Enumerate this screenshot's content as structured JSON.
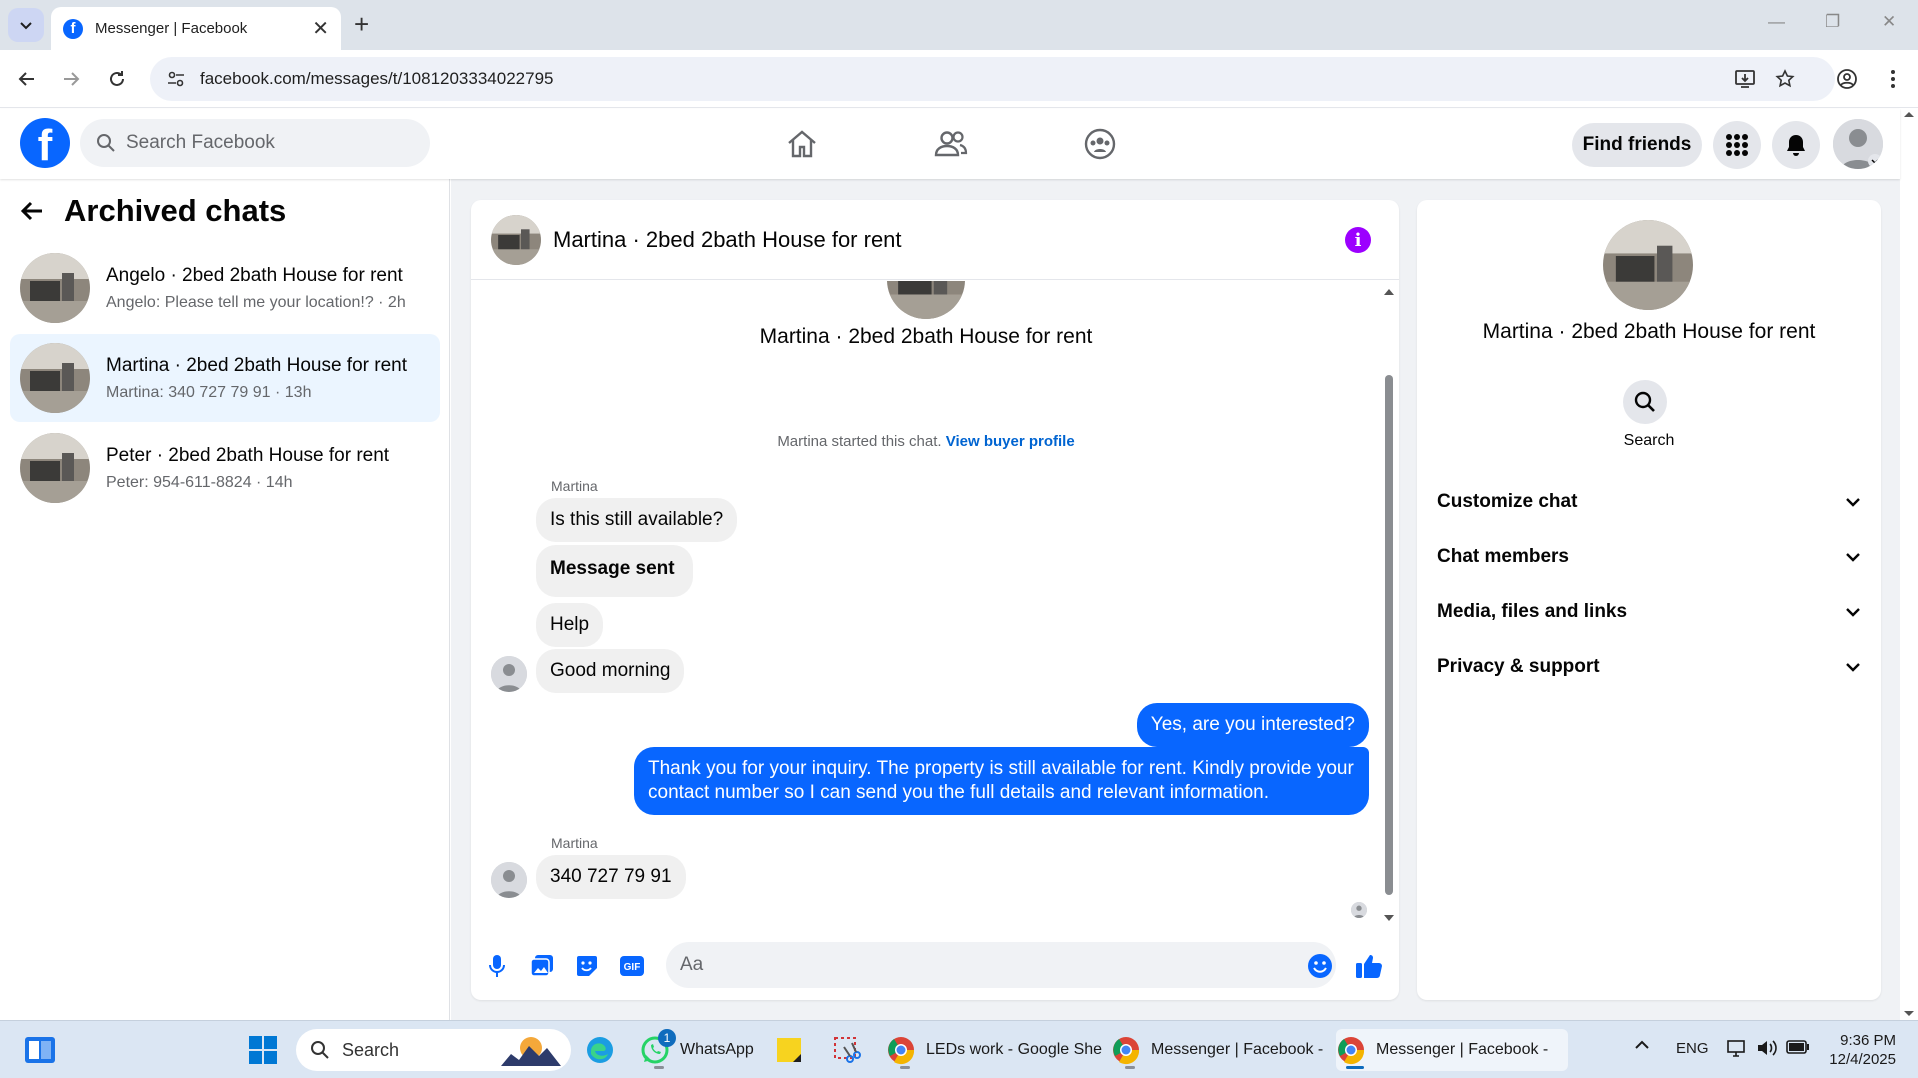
{
  "browser": {
    "tab_title": "Messenger | Facebook",
    "url": "facebook.com/messages/t/1081203334022795"
  },
  "fb_header": {
    "search_placeholder": "Search Facebook",
    "find_friends": "Find friends"
  },
  "sidebar": {
    "title": "Archived chats",
    "chats": [
      {
        "name": "Angelo · 2bed 2bath House for rent",
        "preview": "Angelo: Please tell me your location!? · 2h",
        "active": false
      },
      {
        "name": "Martina · 2bed 2bath House for rent",
        "preview": "Martina: 340 727 79 91 · 13h",
        "active": true
      },
      {
        "name": "Peter · 2bed 2bath House for rent",
        "preview": "Peter: 954-611-8824 · 14h",
        "active": false
      }
    ]
  },
  "chat": {
    "header_name": "Martina · 2bed 2bath House for rent",
    "conversation_title": "Martina · 2bed 2bath House for rent",
    "start_note": "Martina started this chat.",
    "start_link": "View buyer profile",
    "messages": [
      {
        "sender": "Martina",
        "text": "Is this still available?",
        "from_me": false
      },
      {
        "text": "Message sent",
        "from_me": false
      },
      {
        "text": "Help",
        "from_me": false
      },
      {
        "text": "Good morning",
        "from_me": false
      },
      {
        "text": "Yes, are you interested?",
        "from_me": true
      },
      {
        "text": "Thank you for your inquiry. The property is still available for rent. Kindly provide your contact number so I can send you the full details and relevant information.",
        "from_me": true
      },
      {
        "sender": "Martina",
        "text": "340 727 79 91",
        "from_me": false
      }
    ],
    "composer_placeholder": "Aa"
  },
  "right_panel": {
    "name": "Martina · 2bed 2bath House for rent",
    "search_label": "Search",
    "sections": [
      "Customize chat",
      "Chat members",
      "Media, files and links",
      "Privacy & support"
    ]
  },
  "taskbar": {
    "search_placeholder": "Search",
    "apps": [
      {
        "label": "WhatsApp",
        "badge": "1"
      },
      {
        "label": "LEDs work - Google She"
      },
      {
        "label": "Messenger | Facebook -"
      },
      {
        "label": "Messenger | Facebook -"
      }
    ],
    "language": "ENG",
    "time": "9:36 PM",
    "date": "12/4/2025"
  },
  "colors": {
    "fb_blue": "#0866ff",
    "active_chat_bg": "#ebf5ff",
    "info_purple": "#9c00ff",
    "incoming_bubble": "#f0f0f0"
  }
}
